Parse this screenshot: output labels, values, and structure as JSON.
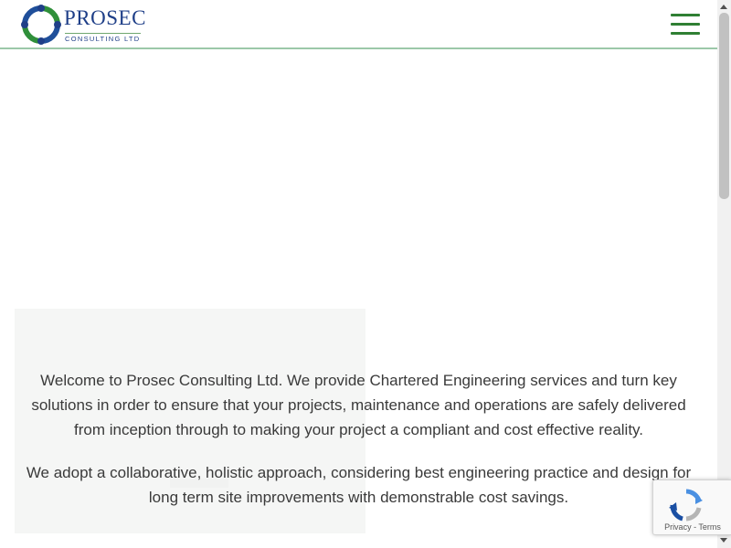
{
  "header": {
    "logo_brand": "PROSEC",
    "logo_tagline": "CONSULTING  LTD",
    "menu_icon": "hamburger-menu-icon",
    "colors": {
      "brand_blue": "#1f3f88",
      "brand_green": "#2f7f33",
      "header_border": "#9cc8a9"
    }
  },
  "intro": {
    "paragraph_1": "Welcome to Prosec Consulting Ltd. We provide Chartered Engineering services and turn key solutions in order to ensure that your projects, maintenance and operations are safely delivered from inception through to making your project a compliant and cost effective reality.",
    "paragraph_2": "We adopt a collaborative, holistic approach, considering best engineering practice and design for long term site improvements with demonstrable cost savings."
  },
  "recaptcha": {
    "icon": "recaptcha-icon",
    "privacy_label": "Privacy",
    "separator": " - ",
    "terms_label": "Terms"
  }
}
